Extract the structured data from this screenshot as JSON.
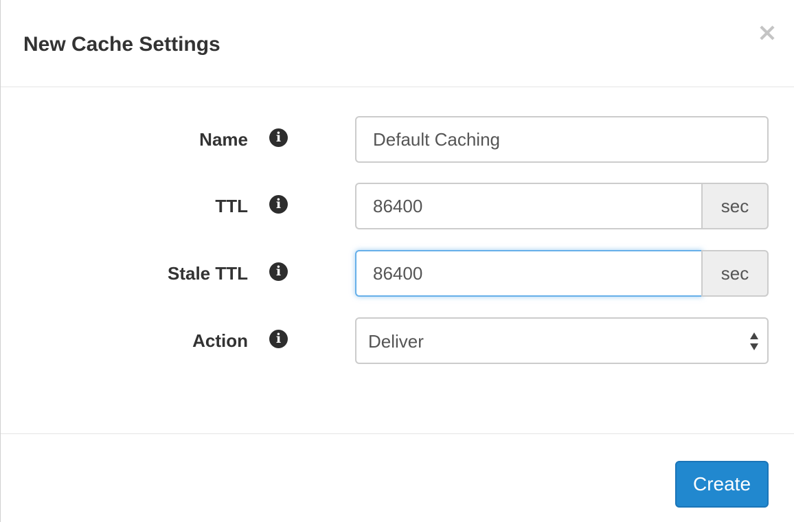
{
  "modal": {
    "title": "New Cache Settings",
    "close_label": "×"
  },
  "form": {
    "name": {
      "label": "Name",
      "value": "Default Caching",
      "info_icon": "info-icon"
    },
    "ttl": {
      "label": "TTL",
      "value": "86400",
      "unit": "sec",
      "info_icon": "info-icon"
    },
    "stale_ttl": {
      "label": "Stale TTL",
      "value": "86400",
      "unit": "sec",
      "info_icon": "info-icon",
      "focused": true
    },
    "action": {
      "label": "Action",
      "selected": "Deliver",
      "info_icon": "info-icon"
    }
  },
  "footer": {
    "create_label": "Create"
  },
  "colors": {
    "primary": "#2188cf",
    "focus": "#66afe9",
    "addon_bg": "#eeeeee",
    "text": "#333333"
  }
}
